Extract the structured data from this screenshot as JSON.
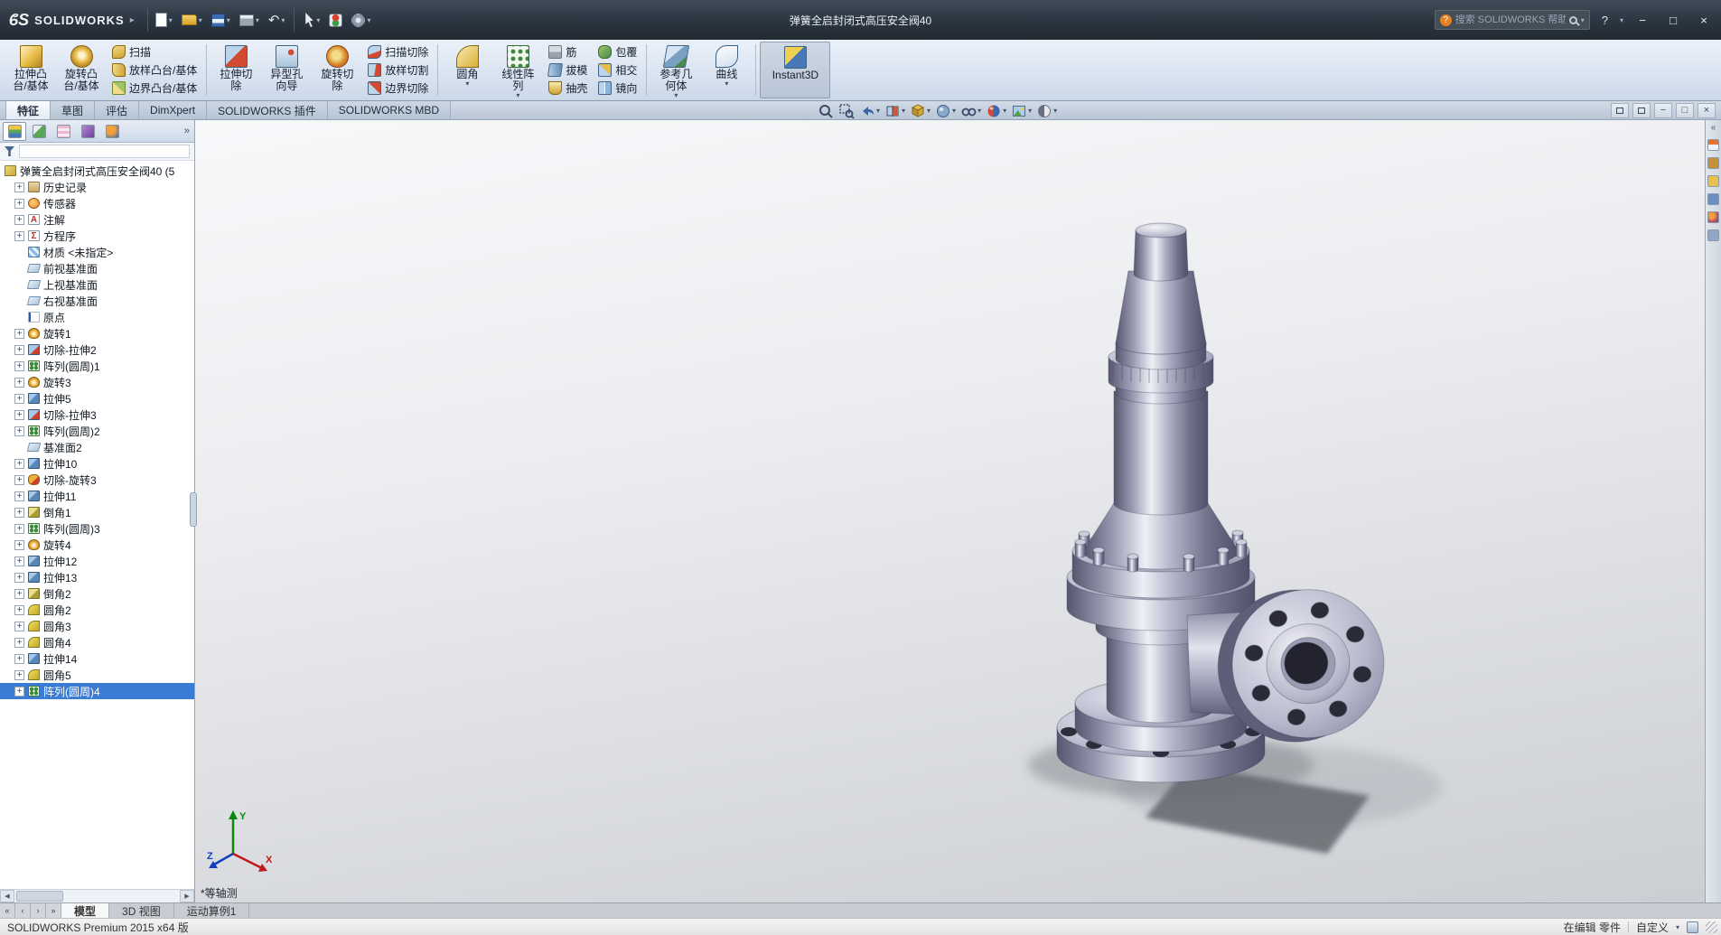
{
  "colors": {
    "titlebar_bg": "#2b3540",
    "ribbon_bg": "#d9e3f0",
    "selection_blue": "#3a7bd5",
    "viewport_top": "#f7f8fa",
    "viewport_bottom": "#cbced3",
    "model_metal": "#9c9cb4"
  },
  "glyphs": {
    "logo_arrow": "▸",
    "caret_down": "▾",
    "undo": "↶",
    "help": "?",
    "minimize": "−",
    "maximize": "□",
    "close": "×",
    "chevron_more": "»",
    "chevron_left": "«",
    "plus": "+",
    "scroll_left": "◀",
    "scroll_right": "▶",
    "nav_first": "«",
    "nav_prev": "‹",
    "nav_next": "›",
    "nav_last": "»",
    "annotation_a": "A",
    "equation_sigma": "Σ"
  },
  "title_bar": {
    "logo_mark": "ϐS",
    "app_name": "SOLIDWORKS",
    "document_title": "弹簧全启封闭式高压安全阀40",
    "search_placeholder": "搜索 SOLIDWORKS 帮助"
  },
  "ribbon": {
    "extrude_boss": "拉伸凸台/基体",
    "revolve_boss": "旋转凸台/基体",
    "sweep": "扫描",
    "loft_boss": "放样凸台/基体",
    "boundary_boss": "边界凸台/基体",
    "extrude_cut": "拉伸切除",
    "hole_wizard": "异型孔向导",
    "revolve_cut": "旋转切除",
    "sweep_cut": "扫描切除",
    "loft_cut": "放样切割",
    "boundary_cut": "边界切除",
    "fillet": "圆角",
    "linear_pattern": "线性阵列",
    "rib": "筋",
    "draft": "拔模",
    "shell": "抽壳",
    "wrap": "包覆",
    "intersect": "相交",
    "mirror": "镜向",
    "reference_geometry": "参考几何体",
    "curves": "曲线",
    "instant3d": "Instant3D"
  },
  "command_tabs": {
    "features": "特征",
    "sketch": "草图",
    "evaluate": "评估",
    "dimxpert": "DimXpert",
    "addins": "SOLIDWORKS 插件",
    "mbd": "SOLIDWORKS MBD"
  },
  "feature_tree": {
    "root_label": "弹簧全启封闭式高压安全阀40 (5",
    "items": [
      {
        "label": "历史记录",
        "icon": "history-folder",
        "expandable": true
      },
      {
        "label": "传感器",
        "icon": "sensors-folder",
        "expandable": true
      },
      {
        "label": "注解",
        "icon": "annotations-folder",
        "expandable": true
      },
      {
        "label": "方程序",
        "icon": "equations-folder",
        "expandable": true
      },
      {
        "label": "材质 <未指定>",
        "icon": "material",
        "expandable": false
      },
      {
        "label": "前视基准面",
        "icon": "plane",
        "expandable": false
      },
      {
        "label": "上视基准面",
        "icon": "plane",
        "expandable": false
      },
      {
        "label": "右视基准面",
        "icon": "plane",
        "expandable": false
      },
      {
        "label": "原点",
        "icon": "origin",
        "expandable": false
      },
      {
        "label": "旋转1",
        "icon": "revolve-feature",
        "expandable": true
      },
      {
        "label": "切除-拉伸2",
        "icon": "cut-extrude-feature",
        "expandable": true
      },
      {
        "label": "阵列(圆周)1",
        "icon": "circular-pattern-feature",
        "expandable": true
      },
      {
        "label": "旋转3",
        "icon": "revolve-feature",
        "expandable": true
      },
      {
        "label": "拉伸5",
        "icon": "extrude-feature",
        "expandable": true
      },
      {
        "label": "切除-拉伸3",
        "icon": "cut-extrude-feature",
        "expandable": true
      },
      {
        "label": "阵列(圆周)2",
        "icon": "circular-pattern-feature",
        "expandable": true
      },
      {
        "label": "基准面2",
        "icon": "plane",
        "expandable": false
      },
      {
        "label": "拉伸10",
        "icon": "extrude-feature",
        "expandable": true
      },
      {
        "label": "切除-旋转3",
        "icon": "cut-revolve-feature",
        "expandable": true
      },
      {
        "label": "拉伸11",
        "icon": "extrude-feature",
        "expandable": true
      },
      {
        "label": "倒角1",
        "icon": "chamfer-feature",
        "expandable": true
      },
      {
        "label": "阵列(圆周)3",
        "icon": "circular-pattern-feature",
        "expandable": true
      },
      {
        "label": "旋转4",
        "icon": "revolve-feature",
        "expandable": true
      },
      {
        "label": "拉伸12",
        "icon": "extrude-feature",
        "expandable": true
      },
      {
        "label": "拉伸13",
        "icon": "extrude-feature",
        "expandable": true
      },
      {
        "label": "倒角2",
        "icon": "chamfer-feature",
        "expandable": true
      },
      {
        "label": "圆角2",
        "icon": "fillet-feature",
        "expandable": true
      },
      {
        "label": "圆角3",
        "icon": "fillet-feature",
        "expandable": true
      },
      {
        "label": "圆角4",
        "icon": "fillet-feature",
        "expandable": true
      },
      {
        "label": "拉伸14",
        "icon": "extrude-feature",
        "expandable": true
      },
      {
        "label": "圆角5",
        "icon": "fillet-feature",
        "expandable": true
      },
      {
        "label": "阵列(圆周)4",
        "icon": "circular-pattern-feature",
        "expandable": true,
        "selected": true
      }
    ]
  },
  "viewport": {
    "view_label": "*等轴测",
    "triad": {
      "x": "X",
      "y": "Y",
      "z": "Z"
    }
  },
  "doc_tabs": {
    "model": "模型",
    "views_3d": "3D 视图",
    "motion_study": "运动算例1"
  },
  "status_bar": {
    "product": "SOLIDWORKS Premium 2015 x64 版",
    "editing": "在编辑 零件",
    "custom": "自定义"
  }
}
